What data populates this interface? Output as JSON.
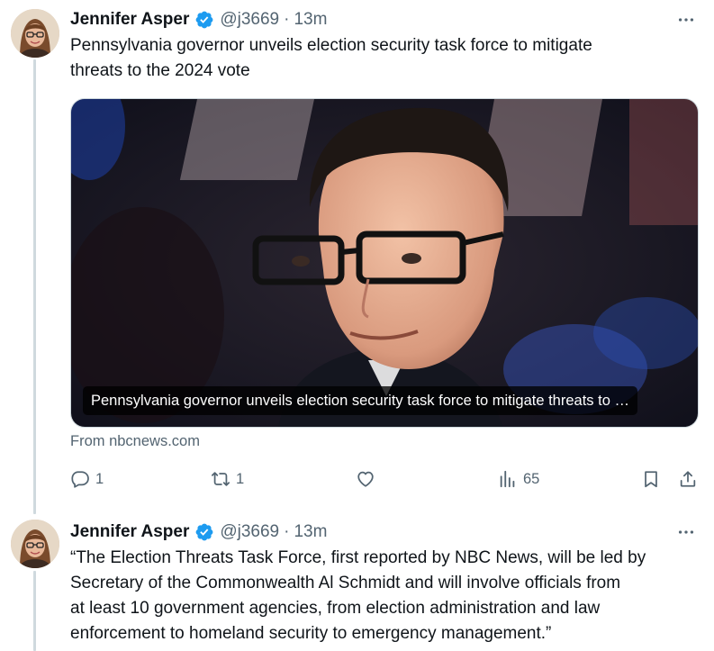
{
  "tweets": [
    {
      "author": {
        "name": "Jennifer Asper",
        "handle": "@j3669",
        "verified": true
      },
      "separator": "·",
      "time": "13m",
      "text_lines": [
        "Pennsylvania governor unveils election security task force to mitigate",
        "threats to the 2024 vote"
      ],
      "card": {
        "caption": "Pennsylvania governor unveils election security task force to mitigate threats to …",
        "source": "From nbcnews.com"
      },
      "actions": {
        "replies": "1",
        "reposts": "1",
        "likes": "",
        "views": "65"
      }
    },
    {
      "author": {
        "name": "Jennifer Asper",
        "handle": "@j3669",
        "verified": true
      },
      "separator": "·",
      "time": "13m",
      "text_lines": [
        "“The Election Threats Task Force, first reported by NBC News, will be led by",
        "Secretary of the Commonwealth Al Schmidt and will involve officials from",
        "at least 10 government agencies, from election administration and law",
        "enforcement to homeland security to emergency management.”"
      ]
    }
  ],
  "icons": {
    "verified": "verified-badge-icon",
    "more": "more-icon",
    "reply": "reply-icon",
    "repost": "repost-icon",
    "like": "heart-icon",
    "views": "views-icon",
    "bookmark": "bookmark-icon",
    "share": "share-icon"
  },
  "colors": {
    "text": "#0f1419",
    "secondary": "#536471",
    "verified": "#1d9bf0",
    "thread_line": "#cfd9de"
  }
}
